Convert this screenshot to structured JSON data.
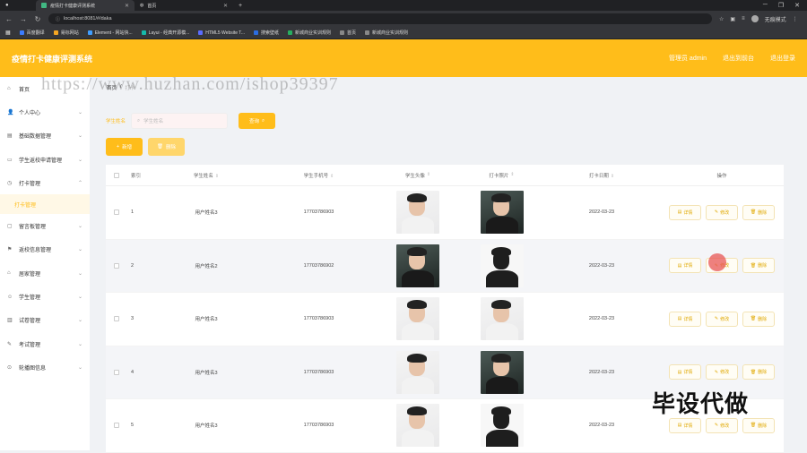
{
  "browser": {
    "tabs": [
      {
        "label": "疫情打卡健康评测系统",
        "active": true
      },
      {
        "label": "首页",
        "active": false
      }
    ],
    "url": "localhost:8081/#/daka",
    "profile_label": "无痕模式",
    "bookmarks": [
      {
        "label": "百度翻译",
        "color": "#3b7cff"
      },
      {
        "label": "易标网站",
        "color": "#f5a623"
      },
      {
        "label": "Element - 网站快...",
        "color": "#409eff"
      },
      {
        "label": "Layui - 经典开源模...",
        "color": "#16baaa"
      },
      {
        "label": "HTML5 Website T...",
        "color": "#5a6cff"
      },
      {
        "label": "搜索壁纸",
        "color": "#2c6de0"
      },
      {
        "label": "新城商业实训规则",
        "color": "#27ae60"
      },
      {
        "label": "首页",
        "color": "#888888"
      },
      {
        "label": "新城商业实训规则",
        "color": "#888888"
      }
    ]
  },
  "header": {
    "title": "疫情打卡健康评测系统",
    "links": [
      "管理员 admin",
      "退出到前台",
      "退出登录"
    ]
  },
  "sidebar": {
    "items": [
      {
        "label": "首页",
        "icon": "home-icon",
        "has_chevron": false
      },
      {
        "label": "个人中心",
        "icon": "user-icon",
        "has_chevron": true
      },
      {
        "label": "基础数据管理",
        "icon": "database-icon",
        "has_chevron": true
      },
      {
        "label": "学生返校申请管理",
        "icon": "document-icon",
        "has_chevron": true
      },
      {
        "label": "打卡管理",
        "icon": "clock-icon",
        "has_chevron": true,
        "expanded": true
      },
      {
        "label": "打卡管理",
        "icon": "",
        "sub": true
      },
      {
        "label": "留言板管理",
        "icon": "message-icon",
        "has_chevron": true
      },
      {
        "label": "返校信息管理",
        "icon": "flag-icon",
        "has_chevron": true
      },
      {
        "label": "居家管理",
        "icon": "house-icon",
        "has_chevron": true
      },
      {
        "label": "学生管理",
        "icon": "student-icon",
        "has_chevron": true
      },
      {
        "label": "试卷管理",
        "icon": "paper-icon",
        "has_chevron": true
      },
      {
        "label": "考试管理",
        "icon": "exam-icon",
        "has_chevron": true
      },
      {
        "label": "轮播图信息",
        "icon": "image-icon",
        "has_chevron": true
      }
    ]
  },
  "breadcrumb": {
    "home": "首页",
    "sep": "/",
    "current": "打卡"
  },
  "watermark": "https://www.huzhan.com/ishop39397",
  "search": {
    "label": "学生姓名",
    "placeholder": "学生姓名",
    "button": "查询"
  },
  "actions": {
    "add": "新增",
    "delete": "删除"
  },
  "table": {
    "columns": [
      "索引",
      "学生姓名",
      "学生手机号",
      "学生头像",
      "打卡照片",
      "打卡日期",
      "操作"
    ],
    "ops": [
      "详情",
      "修改",
      "删除"
    ],
    "rows": [
      {
        "index": "1",
        "name": "用户姓名3",
        "phone": "17703786903",
        "avatar": "light",
        "photo": "dark",
        "date": "2022-03-23"
      },
      {
        "index": "2",
        "name": "用户姓名2",
        "phone": "17703786902",
        "avatar": "dark",
        "photo": "shadow",
        "date": "2022-03-23"
      },
      {
        "index": "3",
        "name": "用户姓名3",
        "phone": "17703786903",
        "avatar": "light",
        "photo": "light",
        "date": "2022-03-23"
      },
      {
        "index": "4",
        "name": "用户姓名3",
        "phone": "17703786903",
        "avatar": "light",
        "photo": "dark",
        "date": "2022-03-23"
      },
      {
        "index": "5",
        "name": "用户姓名3",
        "phone": "17703786903",
        "avatar": "light",
        "photo": "shadow",
        "date": "2022-03-23"
      }
    ]
  },
  "overlay_text": "毕设代做",
  "colors": {
    "accent": "#ffbd1a"
  }
}
